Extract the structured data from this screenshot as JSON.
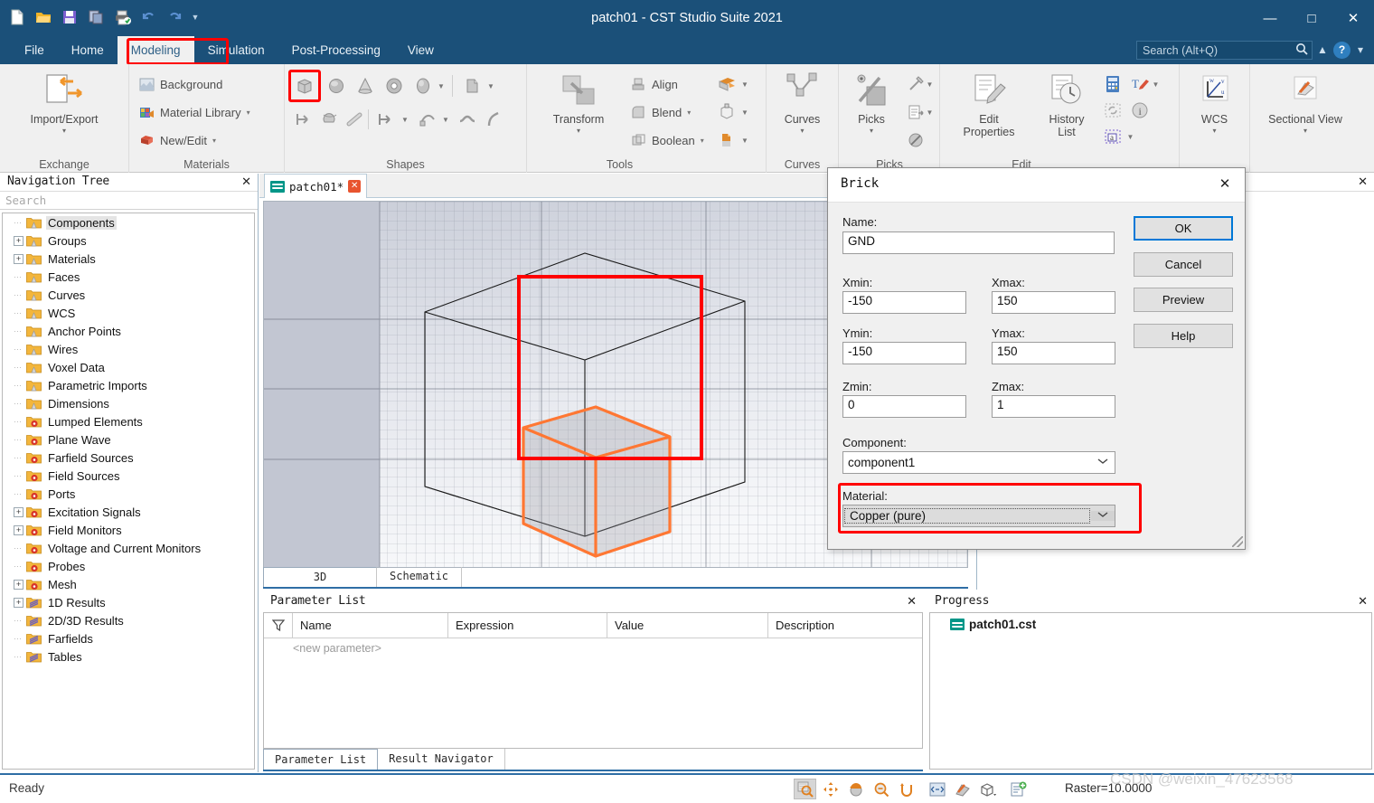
{
  "window": {
    "title": "patch01 - CST Studio Suite 2021",
    "minimize": "─",
    "maximize": "☐",
    "close": "✕"
  },
  "quick_access": [
    {
      "name": "new-document-icon",
      "glyph": "new"
    },
    {
      "name": "open-folder-icon",
      "glyph": "open"
    },
    {
      "name": "save-icon",
      "glyph": "save"
    },
    {
      "name": "copy-icon",
      "glyph": "copy"
    },
    {
      "name": "print-icon",
      "glyph": "print"
    },
    {
      "name": "undo-icon",
      "glyph": "↶"
    },
    {
      "name": "redo-icon",
      "glyph": "↷"
    },
    {
      "name": "customize-qat-icon",
      "glyph": "⌄"
    }
  ],
  "ribbon_tabs": [
    {
      "label": "File",
      "active": false
    },
    {
      "label": "Home",
      "active": false
    },
    {
      "label": "Modeling",
      "active": true,
      "highlighted": true
    },
    {
      "label": "Simulation",
      "active": false
    },
    {
      "label": "Post-Processing",
      "active": false
    },
    {
      "label": "View",
      "active": false
    }
  ],
  "search": {
    "placeholder": "Search (Alt+Q)",
    "icon": "search-icon",
    "collapse_icon": "▲",
    "help_icon": "?",
    "help_caret": "▾"
  },
  "ribbon": {
    "groups": [
      {
        "label": "Exchange",
        "big_button": {
          "label_line1": "Import/Export",
          "label_line2": "",
          "caret": "▾",
          "icon": "import-export-icon"
        }
      },
      {
        "label": "Materials",
        "items": [
          {
            "label": "Background",
            "icon": "background-icon",
            "caret": ""
          },
          {
            "label": "Material Library",
            "icon": "material-library-icon",
            "caret": "▾"
          },
          {
            "label": "New/Edit",
            "icon": "new-edit-material-icon",
            "caret": "▾"
          }
        ]
      },
      {
        "label": "Shapes",
        "row1": [
          {
            "name": "brick-icon",
            "highlighted": true
          },
          {
            "name": "sphere-icon",
            "highlighted": false
          },
          {
            "name": "cone-icon",
            "highlighted": false
          },
          {
            "name": "torus-icon",
            "highlighted": false
          },
          {
            "name": "ellipsoid-icon",
            "highlighted": false
          },
          {
            "name": "shapes-more-caret",
            "caret": "▾"
          },
          {
            "name": "extrude-shape-icon",
            "highlighted": false
          },
          {
            "name": "extrude-caret",
            "caret": "▾"
          }
        ],
        "row2": [
          {
            "name": "extrude-face-icon"
          },
          {
            "name": "rotate-face-icon"
          },
          {
            "name": "loft-icon"
          },
          {
            "name": "extrude-curve-icon"
          },
          {
            "name": "extrude-curve-caret",
            "caret": "▾"
          },
          {
            "name": "trace-from-curve-icon"
          },
          {
            "name": "trace-caret",
            "caret": "▾"
          },
          {
            "name": "bend-sheet-icon"
          },
          {
            "name": "wire-icon"
          }
        ]
      },
      {
        "label": "Tools",
        "big_button": {
          "label_line1": "Transform",
          "caret": "▾",
          "icon": "transform-icon"
        },
        "items": [
          {
            "label": "Align",
            "icon": "align-icon",
            "caret": ""
          },
          {
            "label": "Blend",
            "icon": "blend-icon",
            "caret": "▾"
          },
          {
            "label": "Boolean",
            "icon": "boolean-icon",
            "caret": "▾"
          }
        ],
        "extra_icons": [
          {
            "name": "shape-tools-icon",
            "caret": "▾"
          },
          {
            "name": "local-modification-icon",
            "caret": "▾"
          },
          {
            "name": "material-apply-icon",
            "caret": "▾"
          }
        ]
      },
      {
        "label": "Curves",
        "big_button": {
          "label_line1": "Curves",
          "caret": "▾",
          "icon": "curves-icon"
        }
      },
      {
        "label": "Picks",
        "big_button": {
          "label_line1": "Picks",
          "caret": "▾",
          "icon": "picks-icon"
        },
        "extra_icons": [
          {
            "name": "pick-point-icon",
            "caret": "▾"
          },
          {
            "name": "pick-lists-icon",
            "caret": "▾"
          },
          {
            "name": "clear-picks-icon",
            "caret": ""
          }
        ]
      },
      {
        "label": "Edit",
        "big_buttons": [
          {
            "label_line1": "Edit",
            "label_line2": "Properties",
            "icon": "edit-properties-icon"
          },
          {
            "label_line1": "History",
            "label_line2": "List",
            "icon": "history-list-icon"
          }
        ],
        "extra_icons": [
          {
            "name": "calculator-icon"
          },
          {
            "name": "rename-icon",
            "caret": "▾"
          },
          {
            "name": "parametric-update-icon"
          },
          {
            "name": "information-icon"
          },
          {
            "name": "comment-icon",
            "caret": "▾"
          }
        ]
      },
      {
        "label": "",
        "big_button": {
          "label_line1": "WCS",
          "caret": "▾",
          "icon": "wcs-icon"
        }
      },
      {
        "label": "",
        "big_button": {
          "label_line1": "Sectional View",
          "caret": "▾",
          "icon": "sectional-view-icon"
        }
      }
    ]
  },
  "nav_tree": {
    "title": "Navigation Tree",
    "close_icon": "✕",
    "search_placeholder": "Search",
    "items": [
      {
        "label": "Components",
        "expand": "",
        "icon": "folder-shape-icon",
        "selected": true
      },
      {
        "label": "Groups",
        "expand": "+",
        "icon": "folder-shape-icon"
      },
      {
        "label": "Materials",
        "expand": "+",
        "icon": "folder-shape-icon"
      },
      {
        "label": "Faces",
        "expand": "",
        "icon": "folder-shape-icon"
      },
      {
        "label": "Curves",
        "expand": "",
        "icon": "folder-shape-icon"
      },
      {
        "label": "WCS",
        "expand": "",
        "icon": "folder-shape-icon"
      },
      {
        "label": "Anchor Points",
        "expand": "",
        "icon": "folder-shape-icon"
      },
      {
        "label": "Wires",
        "expand": "",
        "icon": "folder-shape-icon"
      },
      {
        "label": "Voxel Data",
        "expand": "",
        "icon": "folder-shape-icon"
      },
      {
        "label": "Parametric Imports",
        "expand": "",
        "icon": "folder-shape-icon"
      },
      {
        "label": "Dimensions",
        "expand": "",
        "icon": "folder-shape-icon"
      },
      {
        "label": "Lumped Elements",
        "expand": "",
        "icon": "folder-gear-icon"
      },
      {
        "label": "Plane Wave",
        "expand": "",
        "icon": "folder-gear-icon"
      },
      {
        "label": "Farfield Sources",
        "expand": "",
        "icon": "folder-gear-icon"
      },
      {
        "label": "Field Sources",
        "expand": "",
        "icon": "folder-gear-icon"
      },
      {
        "label": "Ports",
        "expand": "",
        "icon": "folder-gear-icon"
      },
      {
        "label": "Excitation Signals",
        "expand": "+",
        "icon": "folder-gear-icon"
      },
      {
        "label": "Field Monitors",
        "expand": "+",
        "icon": "folder-gear-icon"
      },
      {
        "label": "Voltage and Current Monitors",
        "expand": "",
        "icon": "folder-gear-icon"
      },
      {
        "label": "Probes",
        "expand": "",
        "icon": "folder-gear-icon"
      },
      {
        "label": "Mesh",
        "expand": "+",
        "icon": "folder-gear-icon"
      },
      {
        "label": "1D Results",
        "expand": "+",
        "icon": "folder-results-icon"
      },
      {
        "label": "2D/3D Results",
        "expand": "",
        "icon": "folder-results-icon"
      },
      {
        "label": "Farfields",
        "expand": "",
        "icon": "folder-results-icon"
      },
      {
        "label": "Tables",
        "expand": "",
        "icon": "folder-results-icon"
      }
    ]
  },
  "document_tab": {
    "label": "patch01*",
    "icon": "cst-file-icon",
    "close_icon": "✕"
  },
  "viewport": {
    "tabs": [
      {
        "label": "3D",
        "active": true
      },
      {
        "label": "Schematic",
        "active": false
      }
    ],
    "annotation_color": "#ff0000",
    "preview_color": "#ff7733"
  },
  "parameter_list": {
    "title": "Parameter List",
    "close_icon": "✕",
    "filter_icon": "filter-icon",
    "columns": [
      "Name",
      "Expression",
      "Value",
      "Description"
    ],
    "rows": [
      {
        "name": "<new parameter>",
        "expression": "",
        "value": "",
        "description": ""
      }
    ]
  },
  "bottom_tabs": [
    {
      "label": "Parameter List",
      "active": true
    },
    {
      "label": "Result Navigator",
      "active": false
    }
  ],
  "progress": {
    "title": "Progress",
    "close_icon": "✕",
    "items": [
      {
        "label": "patch01.cst",
        "icon": "cst-file-icon"
      }
    ]
  },
  "dialog": {
    "title": "Brick",
    "close_icon": "✕",
    "fields": {
      "name_label": "Name:",
      "name_value": "GND",
      "xmin_label": "Xmin:",
      "xmin_value": "-150",
      "xmax_label": "Xmax:",
      "xmax_value": "150",
      "ymin_label": "Ymin:",
      "ymin_value": "-150",
      "ymax_label": "Ymax:",
      "ymax_value": "150",
      "zmin_label": "Zmin:",
      "zmin_value": "0",
      "zmax_label": "Zmax:",
      "zmax_value": "1",
      "component_label": "Component:",
      "component_value": "component1",
      "material_label": "Material:",
      "material_value": "Copper (pure)"
    },
    "buttons": [
      {
        "label": "OK",
        "primary": true
      },
      {
        "label": "Cancel",
        "primary": false
      },
      {
        "label": "Preview",
        "primary": false
      },
      {
        "label": "Help",
        "primary": false
      }
    ],
    "dropdown_caret": "⌄"
  },
  "statusbar": {
    "status": "Ready",
    "raster": "Raster=10.0000",
    "icons": [
      {
        "name": "zoom-tool-icon",
        "active": true
      },
      {
        "name": "pan-tool-icon",
        "active": false
      },
      {
        "name": "rotate-tool-icon",
        "active": false
      },
      {
        "name": "zoom-out-tool-icon",
        "active": false
      },
      {
        "name": "rotate-view-plane-icon",
        "active": false
      },
      {
        "name": "fit-to-screen-icon",
        "active": false
      },
      {
        "name": "perspective-view-icon",
        "active": false
      },
      {
        "name": "view-cube-icon",
        "active": false
      },
      {
        "name": "screenshot-icon",
        "active": false
      }
    ]
  },
  "watermark": "CSDN @weixin_47623568"
}
